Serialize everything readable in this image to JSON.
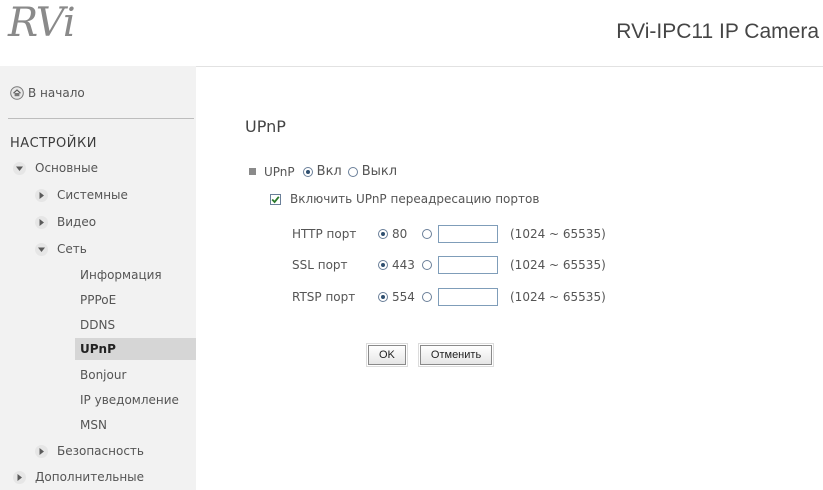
{
  "header": {
    "logo": "RVi",
    "product_title": "RVi-IPC11 IP Camera"
  },
  "sidebar": {
    "home_label": "В начало",
    "section_title": "НАСТРОЙКИ",
    "basic": "Основные",
    "system": "Системные",
    "video": "Видео",
    "network": "Сеть",
    "network_items": [
      "Информация",
      "PPPoE",
      "DDNS",
      "UPnP",
      "Bonjour",
      "IP уведомление",
      "MSN"
    ],
    "active_item": "UPnP",
    "security": "Безопасность",
    "advanced": "Дополнительные"
  },
  "main": {
    "title": "UPnP",
    "upnp_label": "UPnP",
    "on_label": "Вкл",
    "off_label": "Выкл",
    "upnp_enabled": true,
    "port_forwarding_label": "Включить UPnP переадресацию портов",
    "port_forwarding_checked": true,
    "ports": [
      {
        "label": "HTTP порт",
        "default": "80",
        "custom_value": "",
        "range": "(1024 ~ 65535)"
      },
      {
        "label": "SSL порт",
        "default": "443",
        "custom_value": "",
        "range": "(1024 ~ 65535)"
      },
      {
        "label": "RTSP порт",
        "default": "554",
        "custom_value": "",
        "range": "(1024 ~ 65535)"
      }
    ],
    "ok_label": "OK",
    "cancel_label": "Отменить"
  },
  "colors": {
    "sidebar_bg": "#f2f2f2",
    "active_bg": "#d6d6d6",
    "input_border": "#7f9db9"
  }
}
